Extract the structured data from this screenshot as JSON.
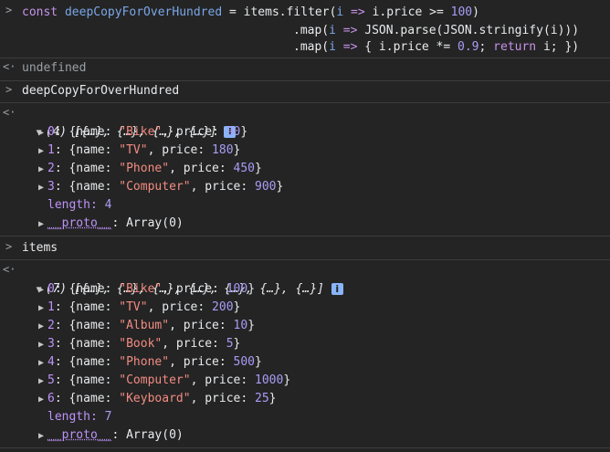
{
  "input1": {
    "l1_const": "const",
    "l1_name": "deepCopyForOverHundred",
    "l1_eq": " = ",
    "l1_items": "items",
    "l1_filter": ".filter(",
    "l1_i": "i",
    "l1_arrow": " => ",
    "l1_expr": "i.price >= ",
    "l1_num": "100",
    "l1_close": ")",
    "l2_map": ".map(",
    "l2_i": "i",
    "l2_arrow": " => ",
    "l2_expr": "JSON.parse(JSON.stringify(i)))",
    "l3_map": ".map(",
    "l3_i": "i",
    "l3_arrow": " => ",
    "l3_open": "{ i.price *= ",
    "l3_num": "0.9",
    "l3_semi": "; ",
    "l3_return": "return",
    "l3_rest": " i; })"
  },
  "output1": "undefined",
  "input2": "deepCopyForOverHundred",
  "result2": {
    "header": "(4) [{…}, {…}, {…}, {…}]",
    "items": [
      {
        "idx": "0",
        "name": "\"Bike\"",
        "price": "90"
      },
      {
        "idx": "1",
        "name": "\"TV\"",
        "price": "180"
      },
      {
        "idx": "2",
        "name": "\"Phone\"",
        "price": "450"
      },
      {
        "idx": "3",
        "name": "\"Computer\"",
        "price": "900"
      }
    ],
    "length_label": "length: ",
    "length": "4",
    "proto_key": "__proto__",
    "proto_val": ": Array(0)"
  },
  "input3": "items",
  "result3": {
    "header": "(7) [{…}, {…}, {…}, {…}, {…}, {…}, {…}]",
    "items": [
      {
        "idx": "0",
        "name": "\"Bike\"",
        "price": "100"
      },
      {
        "idx": "1",
        "name": "\"TV\"",
        "price": "200"
      },
      {
        "idx": "2",
        "name": "\"Album\"",
        "price": "10"
      },
      {
        "idx": "3",
        "name": "\"Book\"",
        "price": "5"
      },
      {
        "idx": "4",
        "name": "\"Phone\"",
        "price": "500"
      },
      {
        "idx": "5",
        "name": "\"Computer\"",
        "price": "1000"
      },
      {
        "idx": "6",
        "name": "\"Keyboard\"",
        "price": "25"
      }
    ],
    "length_label": "length: ",
    "length": "7",
    "proto_key": "__proto__",
    "proto_val": ": Array(0)"
  },
  "labels": {
    "prompt": ">",
    "return": "<·",
    "info": "i",
    "name_key": "{name: ",
    "price_key": ", price: ",
    "close": "}"
  }
}
